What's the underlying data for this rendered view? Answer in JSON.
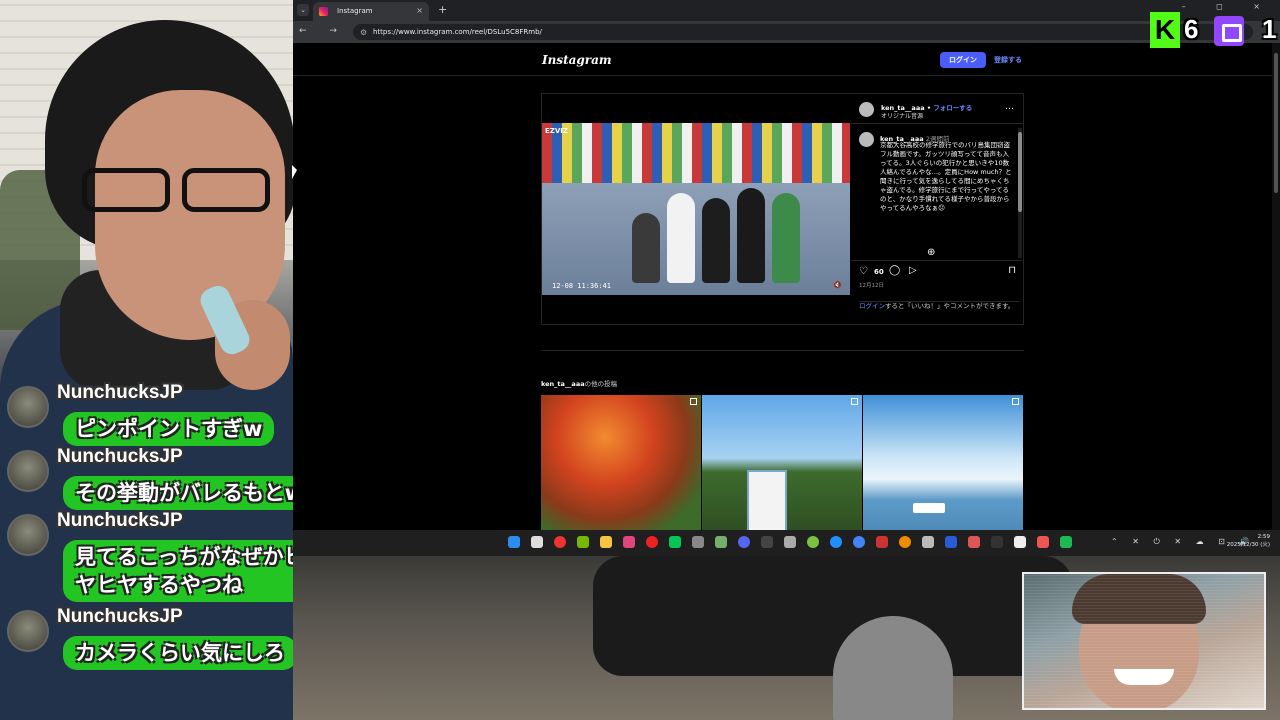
{
  "browser": {
    "tab_title": "Instagram",
    "url": "https://www.instagram.com/reel/DSLu5C8FRmb/",
    "new_tab": "+",
    "tab_close": "×",
    "tab_menu": "⌄",
    "nav_buttons": "← → ⟳",
    "window_controls": "– ◻ ×"
  },
  "instagram": {
    "logo": "Instagram",
    "login_button": "ログイン",
    "signup_link": "登録する",
    "post": {
      "username": "ken_ta__aaa",
      "follow": "フォローする",
      "audio": "オリジナル音源",
      "more": "…",
      "caption_user": "ken_ta__aaa",
      "caption_time": "2週間前",
      "caption": "京都大谷高校の修学旅行でのバリ島集団窃盗フル動画です。ガッツリ顔写ってて音声も入ってる。3人ぐらいの犯行かと思いきや10数人絡んでるんやな…。定員にHow much？と聞きに行って気を逸らしてる間にめちゃくちゃ盗んでる。修学旅行にまで行ってやってるのと、かなり手慣れてる様子やから普段からやってるんやろなぁ😕",
      "likes": "60",
      "date": "12月12日",
      "login_note_link": "ログイン",
      "login_note_rest": "すると「いいね！」やコメントができます。",
      "video_brand": "EZVIZ",
      "video_timestamp": "12-08  11:36:41",
      "add_comment": "⊕"
    },
    "more_posts_user": "ken_ta__aaa",
    "more_posts_suffix": "の他の投稿"
  },
  "chat": [
    {
      "author": "NunchucksJP",
      "text": "ピンポイントすぎw"
    },
    {
      "author": "NunchucksJP",
      "text": "その挙動がバレるもとw"
    },
    {
      "author": "NunchucksJP",
      "text": "見てるこっちがなぜかヒヤヒヤするやつね"
    },
    {
      "author": "NunchucksJP",
      "text": "カメラくらい気にしろ"
    }
  ],
  "overlay": {
    "kick_letter": "K",
    "kick_viewers": "6",
    "twitch_viewers": "1"
  },
  "taskbar": {
    "time": "2:59",
    "date": "2025/12/30 (火)",
    "tray": "⌃ ✕ ⏻ ✕ ☁ ⊡ 🔊"
  },
  "colors": {
    "instagram_blue": "#4a5df9",
    "chat_bubble": "#22c522",
    "kick_green": "#53fc18",
    "twitch_purple": "#9146ff"
  },
  "icons": {
    "heart": "♡",
    "comment": "◯",
    "share": "▷",
    "save": "⊓"
  }
}
